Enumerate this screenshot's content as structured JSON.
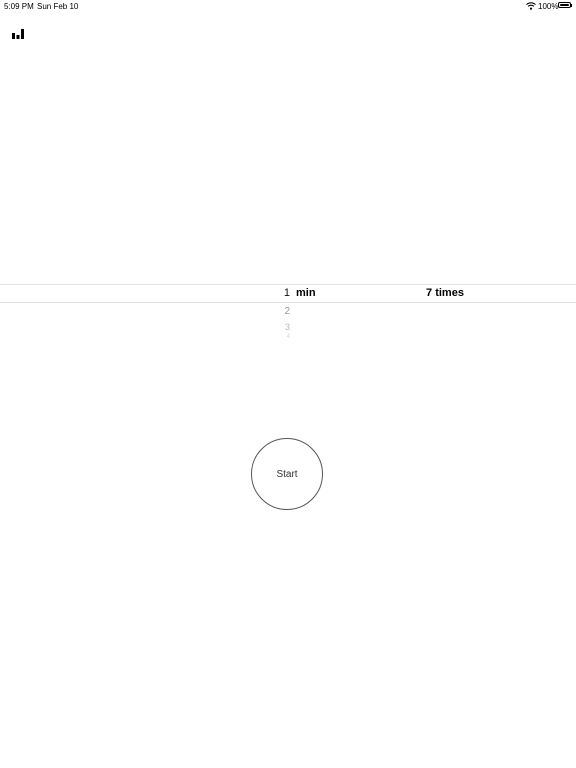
{
  "status_bar": {
    "time": "5:09 PM",
    "date": "Sun Feb 10",
    "battery_percent": "100%",
    "battery_level": 1.0,
    "wifi_icon": "wifi-icon",
    "battery_icon": "battery-icon"
  },
  "toolbar": {
    "stats_icon": "bar-chart-icon"
  },
  "picker": {
    "minutes": {
      "selected": "1",
      "unit": "min",
      "options": [
        "2",
        "3",
        "4"
      ]
    },
    "repeat": {
      "selected": "7 times"
    }
  },
  "start_button": {
    "label": "Start"
  }
}
